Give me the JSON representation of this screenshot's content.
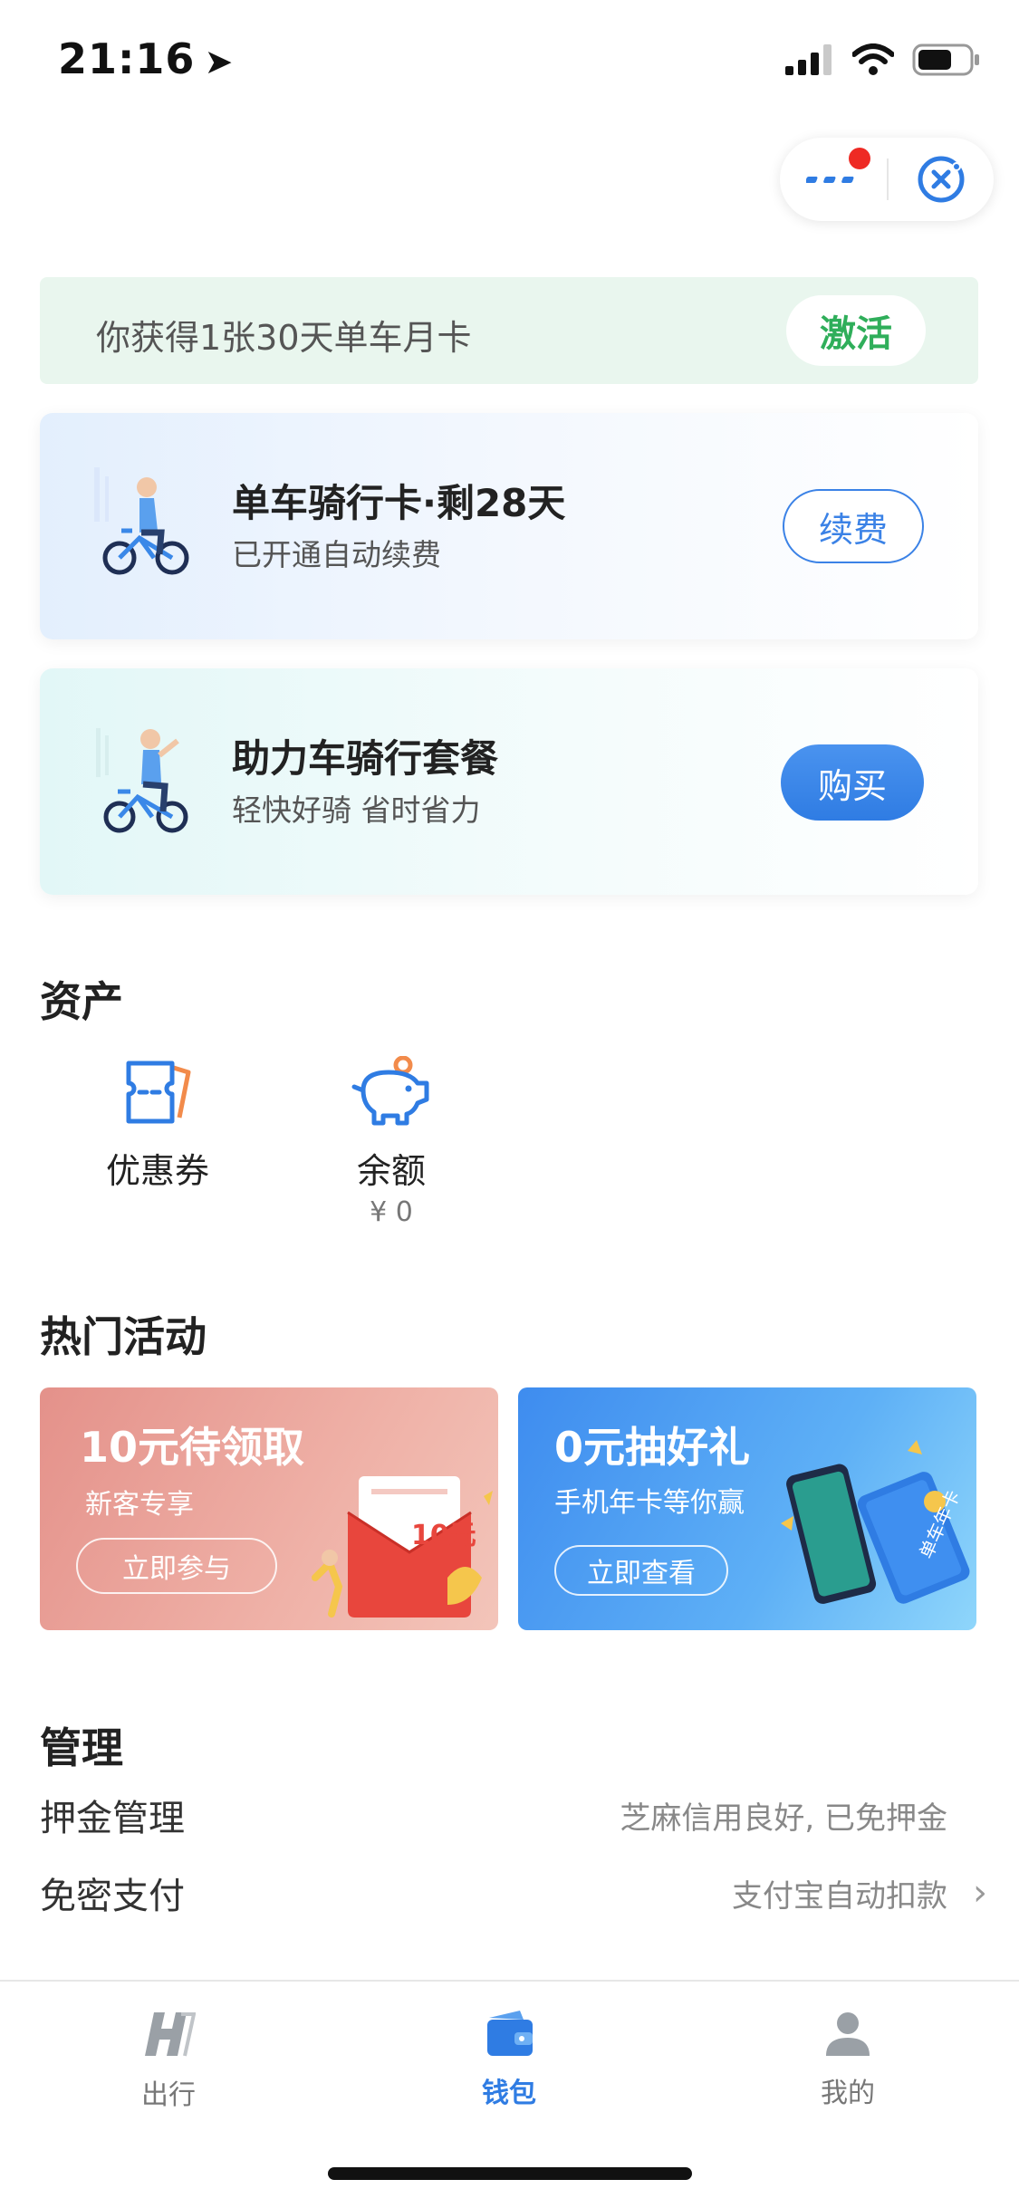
{
  "status_bar": {
    "time": "21:16",
    "location_icon": "location-arrow-icon",
    "signal_icon": "cellular-signal-icon",
    "wifi_icon": "wifi-icon",
    "battery_icon": "battery-icon"
  },
  "top_capsule": {
    "more_icon": "more-dots-icon",
    "close_icon": "close-target-icon",
    "badge_color": "#ee2a24"
  },
  "promo": {
    "text": "你获得1张30天单车月卡",
    "button": "激活"
  },
  "cards": [
    {
      "title": "单车骑行卡·剩28天",
      "subtitle": "已开通自动续费",
      "button": "续费",
      "icon": "bicycle-rider-icon"
    },
    {
      "title": "助力车骑行套餐",
      "subtitle": "轻快好骑 省时省力",
      "button": "购买",
      "icon": "ebike-rider-icon"
    }
  ],
  "assets": {
    "title": "资产",
    "items": [
      {
        "label": "优惠券",
        "icon": "coupon-icon"
      },
      {
        "label": "余额",
        "value": "¥ 0",
        "icon": "piggy-bank-icon"
      }
    ]
  },
  "activities": {
    "title": "热门活动",
    "banners": [
      {
        "title": "10元待领取",
        "subtitle": "新客专享",
        "button": "立即参与",
        "coupon_amount": "10元"
      },
      {
        "title": "0元抽好礼",
        "subtitle": "手机年卡等你赢",
        "button": "立即查看",
        "card_text": "单车年卡"
      }
    ]
  },
  "manage": {
    "title": "管理",
    "rows": [
      {
        "label": "押金管理",
        "value": "芝麻信用良好, 已免押金"
      },
      {
        "label": "免密支付",
        "value": "支付宝自动扣款"
      }
    ]
  },
  "tabbar": {
    "tabs": [
      {
        "label": "出行",
        "icon": "hellobike-logo-icon"
      },
      {
        "label": "钱包",
        "icon": "wallet-icon"
      },
      {
        "label": "我的",
        "icon": "user-icon"
      }
    ],
    "active_index": 1,
    "active_color": "#2f7ce3"
  }
}
